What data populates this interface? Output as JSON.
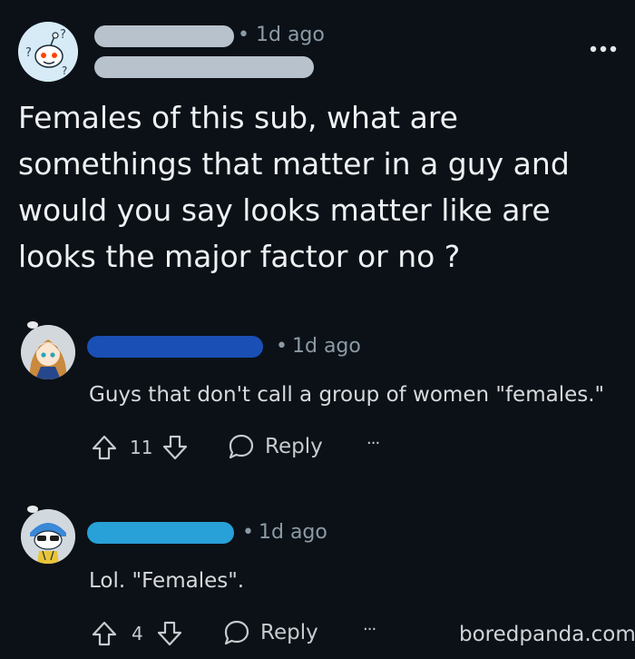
{
  "post": {
    "time": "1d ago",
    "title": "Females of this sub, what are somethings that matter in a guy and would you say looks matter like are looks the major factor or no ?",
    "avatar_icon": "snoo-question-icon",
    "more_icon": "kebab-menu-icon"
  },
  "comments": [
    {
      "time": "1d ago",
      "text": "Guys that don't call a group of women \"females.\"",
      "votes": "11",
      "reply_label": "Reply",
      "more_label": "···",
      "redact_color": "#1a4fb5"
    },
    {
      "time": "1d ago",
      "text": "Lol. \"Females\".",
      "votes": "4",
      "reply_label": "Reply",
      "more_label": "···",
      "redact_color": "#28a0d8"
    }
  ],
  "colors": {
    "background": "#0b1117",
    "post_redact": "#b8c2cc",
    "meta_text": "#8c9aa5"
  },
  "watermark": "boredpanda.com"
}
